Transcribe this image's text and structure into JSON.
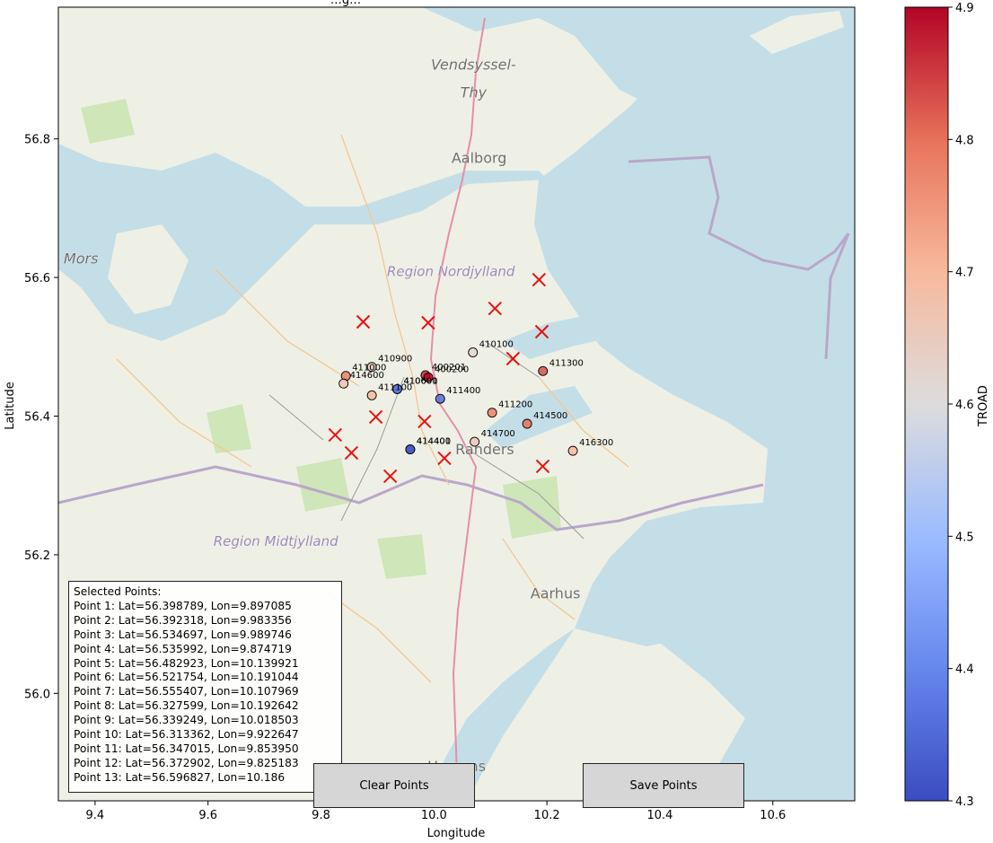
{
  "chart_data": {
    "type": "scatter",
    "title": "…g…",
    "xlabel": "Longitude",
    "ylabel": "Latitude",
    "xlim": [
      9.335,
      10.745
    ],
    "ylim": [
      55.845,
      56.99
    ],
    "xticks": [
      "9.4",
      "9.6",
      "9.8",
      "10.0",
      "10.2",
      "10.4",
      "10.6"
    ],
    "xtick_values": [
      9.4,
      9.6,
      9.8,
      10.0,
      10.2,
      10.4,
      10.6
    ],
    "yticks": [
      "56.0",
      "56.2",
      "56.4",
      "56.6",
      "56.8"
    ],
    "ytick_values": [
      56.0,
      56.2,
      56.4,
      56.6,
      56.8
    ],
    "basemap_labels": [
      {
        "text": "Vendsyssel-",
        "lon": 10.07,
        "lat": 56.9
      },
      {
        "text": "Thy",
        "lon": 10.07,
        "lat": 56.86
      },
      {
        "text": "Aalborg",
        "lon": 10.08,
        "lat": 56.765
      },
      {
        "text": "Mors",
        "lon": 9.375,
        "lat": 56.62
      },
      {
        "text": "Region Nordjylland",
        "lon": 10.03,
        "lat": 56.602
      },
      {
        "text": "Region Midtjylland",
        "lon": 9.72,
        "lat": 56.213
      },
      {
        "text": "Randers",
        "lon": 10.09,
        "lat": 56.345
      },
      {
        "text": "Aarhus",
        "lon": 10.215,
        "lat": 56.137
      },
      {
        "text": "Horsens",
        "lon": 10.04,
        "lat": 55.888
      }
    ],
    "colorbar": {
      "label": "TROAD",
      "min": 4.3,
      "max": 4.9,
      "ticks": [
        "4.3",
        "4.4",
        "4.5",
        "4.6",
        "4.7",
        "4.8",
        "4.9"
      ],
      "tick_values": [
        4.3,
        4.4,
        4.5,
        4.6,
        4.7,
        4.8,
        4.9
      ],
      "colormap": "coolwarm"
    },
    "stations": [
      {
        "id": "410100",
        "lon": 10.069,
        "lat": 56.492,
        "troad": 4.62
      },
      {
        "id": "410900",
        "lon": 9.89,
        "lat": 56.471,
        "troad": 4.64
      },
      {
        "id": "400201",
        "lon": 9.985,
        "lat": 56.459,
        "troad": 4.86
      },
      {
        "id": "400200",
        "lon": 9.99,
        "lat": 56.456,
        "troad": 4.9
      },
      {
        "id": "411000",
        "lon": 9.844,
        "lat": 56.458,
        "troad": 4.78
      },
      {
        "id": "414600",
        "lon": 9.84,
        "lat": 56.447,
        "troad": 4.67
      },
      {
        "id": "410600",
        "lon": 9.935,
        "lat": 56.439,
        "troad": 4.37
      },
      {
        "id": "410601",
        "lon": 9.935,
        "lat": 56.439,
        "troad": 4.37
      },
      {
        "id": "411100",
        "lon": 9.89,
        "lat": 56.43,
        "troad": 4.7
      },
      {
        "id": "411400",
        "lon": 10.011,
        "lat": 56.425,
        "troad": 4.36
      },
      {
        "id": "411300",
        "lon": 10.193,
        "lat": 56.465,
        "troad": 4.83
      },
      {
        "id": "411200",
        "lon": 10.103,
        "lat": 56.405,
        "troad": 4.78
      },
      {
        "id": "414500",
        "lon": 10.165,
        "lat": 56.389,
        "troad": 4.8
      },
      {
        "id": "414700",
        "lon": 10.072,
        "lat": 56.363,
        "troad": 4.66
      },
      {
        "id": "414400",
        "lon": 9.958,
        "lat": 56.352,
        "troad": 4.32
      },
      {
        "id": "414401",
        "lon": 9.958,
        "lat": 56.352,
        "troad": 4.32
      },
      {
        "id": "416300",
        "lon": 10.246,
        "lat": 56.35,
        "troad": 4.7
      }
    ],
    "selected_points": [
      {
        "lat": 56.398789,
        "lon": 9.897085
      },
      {
        "lat": 56.392318,
        "lon": 9.983356
      },
      {
        "lat": 56.534697,
        "lon": 9.989746
      },
      {
        "lat": 56.535992,
        "lon": 9.874719
      },
      {
        "lat": 56.482923,
        "lon": 10.139921
      },
      {
        "lat": 56.521754,
        "lon": 10.191044
      },
      {
        "lat": 56.555407,
        "lon": 10.107969
      },
      {
        "lat": 56.327599,
        "lon": 10.192642
      },
      {
        "lat": 56.339249,
        "lon": 10.018503
      },
      {
        "lat": 56.313362,
        "lon": 9.922647
      },
      {
        "lat": 56.347015,
        "lon": 9.85395
      },
      {
        "lat": 56.372902,
        "lon": 9.825183
      },
      {
        "lat": 56.596827,
        "lon": 10.186
      }
    ]
  },
  "info_box": {
    "header": "Selected Points:",
    "lines": [
      "Point 1: Lat=56.398789, Lon=9.897085",
      "Point 2: Lat=56.392318, Lon=9.983356",
      "Point 3: Lat=56.534697, Lon=9.989746",
      "Point 4: Lat=56.535992, Lon=9.874719",
      "Point 5: Lat=56.482923, Lon=10.139921",
      "Point 6: Lat=56.521754, Lon=10.191044",
      "Point 7: Lat=56.555407, Lon=10.107969",
      "Point 8: Lat=56.327599, Lon=10.192642",
      "Point 9: Lat=56.339249, Lon=10.018503",
      "Point 10: Lat=56.313362, Lon=9.922647",
      "Point 11: Lat=56.347015, Lon=9.853950",
      "Point 12: Lat=56.372902, Lon=9.825183",
      "Point 13: Lat=56.596827, Lon=10.186"
    ]
  },
  "buttons": {
    "clear_label": "Clear Points",
    "save_label": "Save Points"
  },
  "colors": {
    "sea": "#c4dee7",
    "land": "#eef0e6",
    "cross": "#e61212"
  }
}
